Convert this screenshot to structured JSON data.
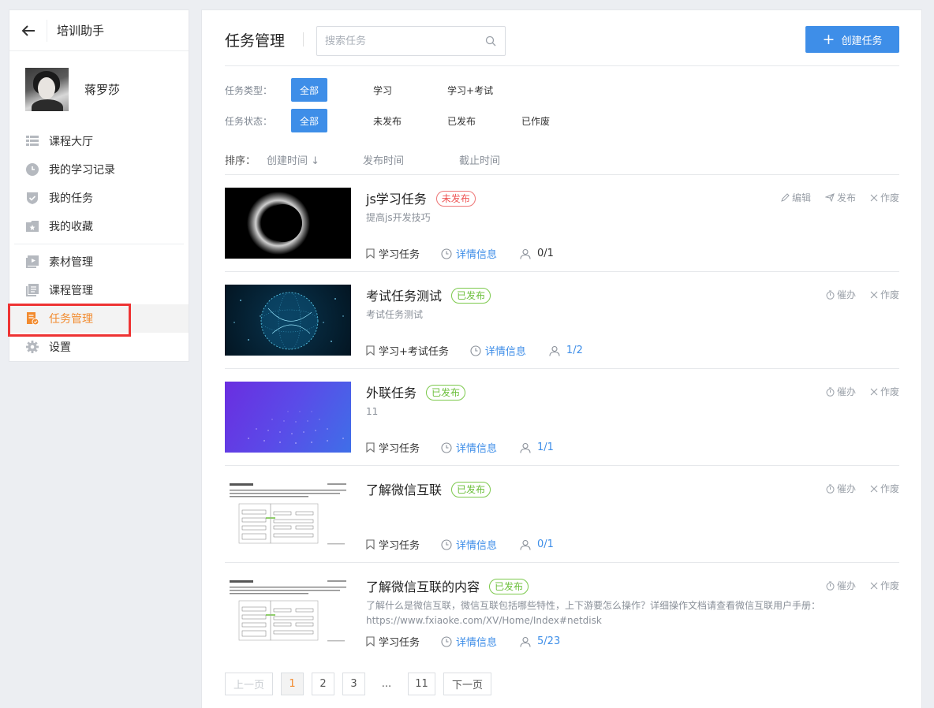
{
  "sidebar": {
    "title": "培训助手",
    "username": "蒋罗莎",
    "menu": [
      {
        "label": "课程大厅",
        "icon": "list-icon"
      },
      {
        "label": "我的学习记录",
        "icon": "clock-icon"
      },
      {
        "label": "我的任务",
        "icon": "shield-check-icon"
      },
      {
        "label": "我的收藏",
        "icon": "folder-icon"
      },
      {
        "label": "素材管理",
        "icon": "video-icon"
      },
      {
        "label": "课程管理",
        "icon": "book-icon"
      },
      {
        "label": "任务管理",
        "icon": "task-doc-icon"
      },
      {
        "label": "设置",
        "icon": "gear-icon"
      }
    ]
  },
  "header": {
    "title": "任务管理",
    "search_placeholder": "搜索任务",
    "create_label": "创建任务"
  },
  "filters": {
    "type_label": "任务类型：",
    "type_options": [
      "全部",
      "学习",
      "学习+考试"
    ],
    "status_label": "任务状态：",
    "status_options": [
      "全部",
      "未发布",
      "已发布",
      "已作废"
    ]
  },
  "sort": {
    "label": "排序：",
    "created": "创建时间 ↓",
    "published": "发布时间",
    "deadline": "截止时间"
  },
  "tasks": [
    {
      "title": "js学习任务",
      "status": "未发布",
      "desc": "提高js开发技巧",
      "type": "学习任务",
      "detail": "详情信息",
      "count": "0/1",
      "actions": [
        "编辑",
        "发布",
        "作废"
      ]
    },
    {
      "title": "考试任务测试",
      "status": "已发布",
      "desc": "考试任务测试",
      "type": "学习+考试任务",
      "detail": "详情信息",
      "count": "1/2",
      "actions": [
        "催办",
        "作废"
      ]
    },
    {
      "title": "外联任务",
      "status": "已发布",
      "desc": "11",
      "type": "学习任务",
      "detail": "详情信息",
      "count": "1/1",
      "actions": [
        "催办",
        "作废"
      ]
    },
    {
      "title": "了解微信互联",
      "status": "已发布",
      "desc": "",
      "type": "学习任务",
      "detail": "详情信息",
      "count": "0/1",
      "actions": [
        "催办",
        "作废"
      ]
    },
    {
      "title": "了解微信互联的内容",
      "status": "已发布",
      "desc": "了解什么是微信互联，微信互联包括哪些特性，上下游要怎么操作？详细操作文档请查看微信互联用户手册：https://www.fxiaoke.com/XV/Home/Index#netdisk",
      "type": "学习任务",
      "detail": "详情信息",
      "count": "5/23",
      "actions": [
        "催办",
        "作废"
      ]
    }
  ],
  "pager": {
    "prev": "上一页",
    "pages": [
      "1",
      "2",
      "3"
    ],
    "ellipsis": "...",
    "last": "11",
    "next": "下一页"
  },
  "colors": {
    "accent": "#3e8ee8",
    "active": "#f28b2f",
    "unpublished": "#ee5555",
    "published": "#6bbf3a"
  }
}
